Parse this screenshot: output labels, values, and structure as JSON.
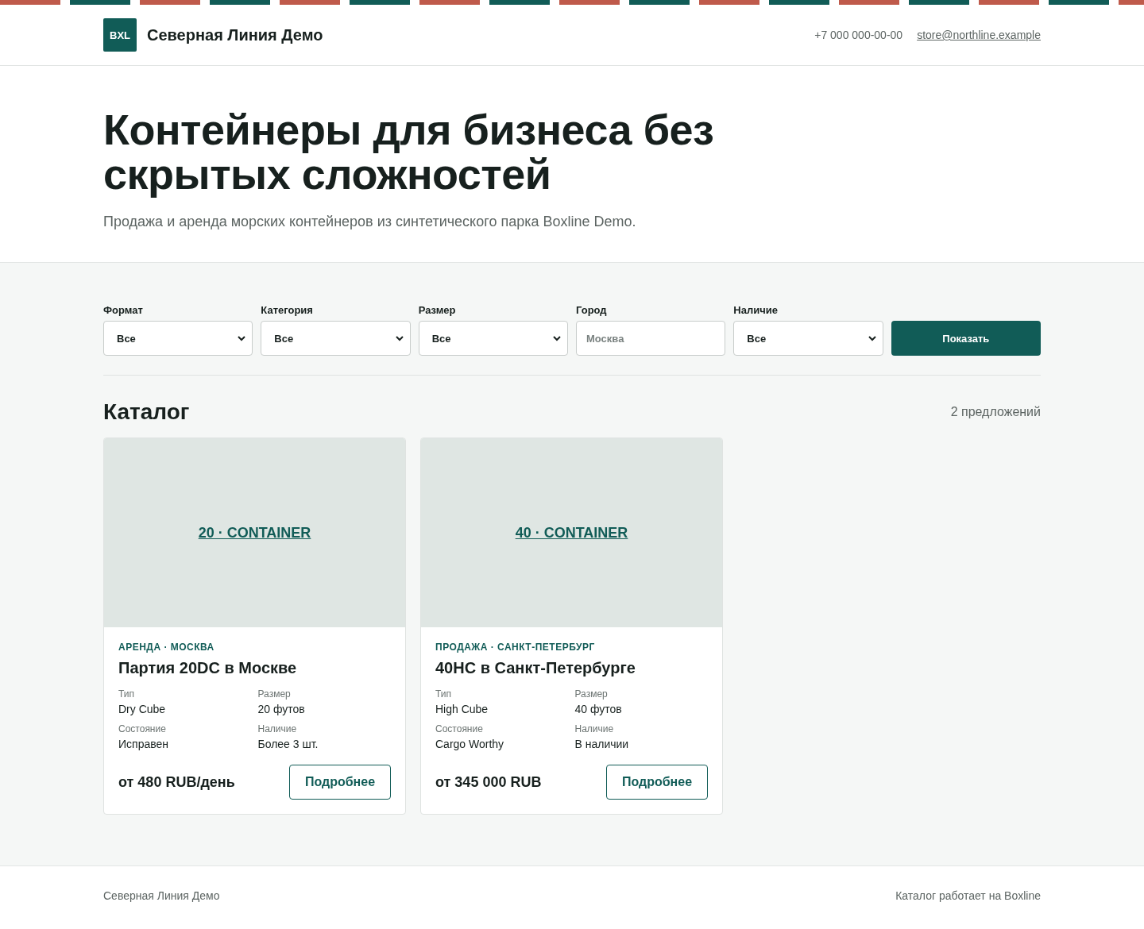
{
  "header": {
    "logo": "BXL",
    "brand": "Северная Линия Демо",
    "phone": "+7 000 000-00-00",
    "email": "store@northline.example"
  },
  "hero": {
    "title": "Контейнеры для бизнеса без скрытых сложностей",
    "subtitle": "Продажа и аренда морских контейнеров из синтетического парка Boxline Demo."
  },
  "filters": [
    {
      "kind": "select",
      "label": "Формат",
      "value": "Все"
    },
    {
      "kind": "select",
      "label": "Категория",
      "value": "Все"
    },
    {
      "kind": "select",
      "label": "Размер",
      "value": "Все"
    },
    {
      "kind": "input",
      "label": "Город",
      "placeholder": "Москва"
    },
    {
      "kind": "select",
      "label": "Наличие",
      "value": "Все"
    }
  ],
  "show_button": "Показать",
  "catalog": {
    "title": "Каталог",
    "count": "2 предложений"
  },
  "cards": [
    {
      "image_label": "20 · CONTAINER",
      "tag": "АРЕНДА · МОСКВА",
      "title": "Партия 20DC в Москве",
      "specs": [
        {
          "label": "Тип",
          "value": "Dry Cube"
        },
        {
          "label": "Размер",
          "value": "20 футов"
        },
        {
          "label": "Состояние",
          "value": "Исправен"
        },
        {
          "label": "Наличие",
          "value": "Более 3 шт."
        }
      ],
      "price": "от 480 RUB/день",
      "button": "Подробнее"
    },
    {
      "image_label": "40 · CONTAINER",
      "tag": "ПРОДАЖА · САНКТ-ПЕТЕРБУРГ",
      "title": "40HC в Санкт-Петербурге",
      "specs": [
        {
          "label": "Тип",
          "value": "High Cube"
        },
        {
          "label": "Размер",
          "value": "40 футов"
        },
        {
          "label": "Состояние",
          "value": "Cargo Worthy"
        },
        {
          "label": "Наличие",
          "value": "В наличии"
        }
      ],
      "price": "от 345 000 RUB",
      "button": "Подробнее"
    }
  ],
  "footer": {
    "left": "Северная Линия Демо",
    "right": "Каталог работает на Boxline"
  }
}
